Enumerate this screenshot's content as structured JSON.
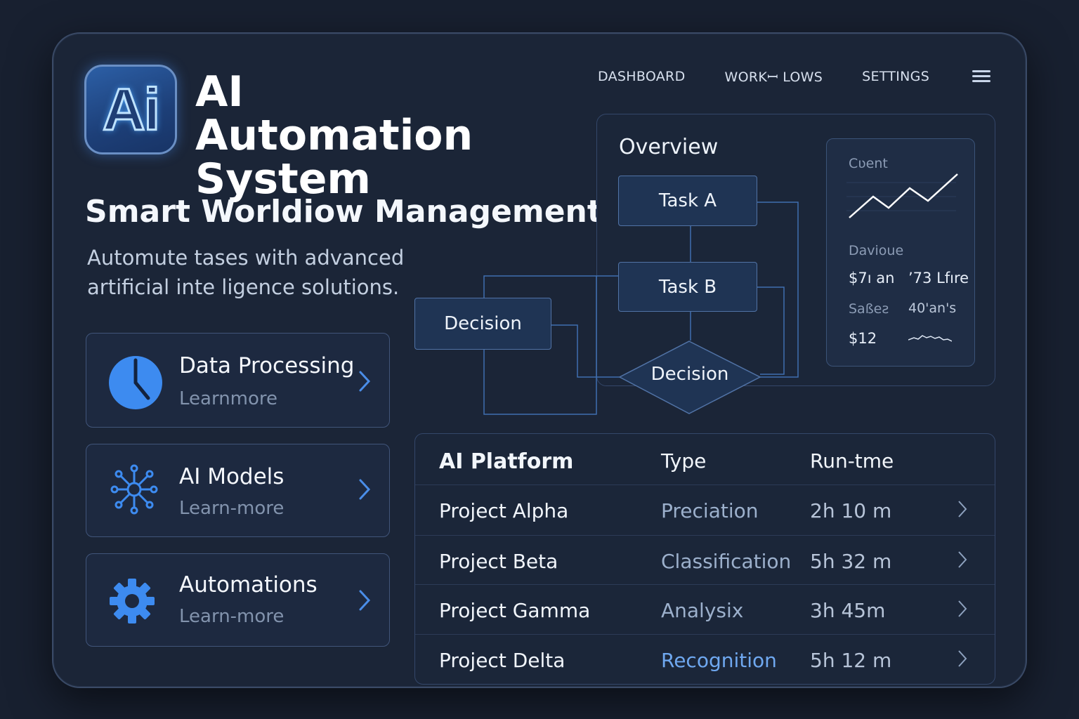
{
  "app": {
    "logo_text": "Ai",
    "title_line1": "AI Automation",
    "title_line2": "System"
  },
  "nav": {
    "items": [
      "DASHBOARD",
      "WORKꟷ LOWS",
      "SETTINGS"
    ],
    "menu_icon": "hamburger-menu-icon"
  },
  "hero": {
    "headline": "Smart Worldiow Management",
    "subtext_line1": "Automute tases with advanced",
    "subtext_line2": "artificial inte ligence solutions."
  },
  "cards": [
    {
      "title": "Data Processing",
      "link": "Learnmore",
      "icon": "clock-icon"
    },
    {
      "title": "AI Models",
      "link": "Learn-more",
      "icon": "network-icon"
    },
    {
      "title": "Automations",
      "link": "Learn-more",
      "icon": "gear-icon"
    }
  ],
  "overview": {
    "title": "Overview",
    "nodes": {
      "task_a": "Task A",
      "task_b": "Task B",
      "decision_left": "Decision",
      "decision_diamond": "Decision"
    },
    "stats": {
      "chart_label": "Cʋent",
      "section_label": "Daviоue",
      "value1": "$7ı an",
      "value2": "ʼ73 Lfıre",
      "label2": "Saßeƨ",
      "value3": "40'an's",
      "value4": "$12"
    }
  },
  "table": {
    "headers": [
      "AI Platform",
      "Type",
      "Run-tme"
    ],
    "rows": [
      {
        "name": "Project Alpha",
        "type": "Preciation",
        "runtime": "2h 10 m"
      },
      {
        "name": "Project Beta",
        "type": "Classification",
        "runtime": "5h 32 m"
      },
      {
        "name": "Project Gamma",
        "type": "Analysix",
        "runtime": "3h 45m"
      },
      {
        "name": "Project Delta",
        "type": "Recognition",
        "runtime": "5h 12 m"
      }
    ]
  },
  "colors": {
    "background": "#182030",
    "panel": "#1b2537",
    "accent": "#3d8bf0",
    "node_fill": "#1f3454",
    "connector": "#3f6fb0"
  }
}
